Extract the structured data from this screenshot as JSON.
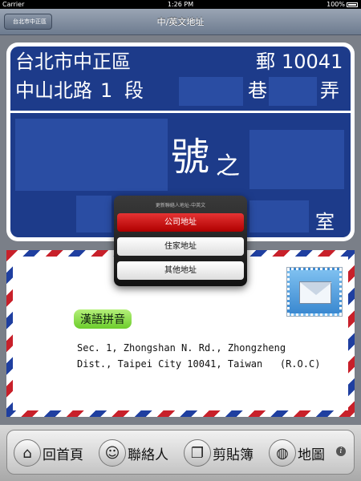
{
  "status_bar": {
    "carrier": "Carrier",
    "time": "1:26 PM",
    "battery": "100%"
  },
  "nav": {
    "back_label": "台北市中正區",
    "title": "中/英文地址"
  },
  "plate": {
    "city_district": "台北市中正區",
    "zip_label": "郵",
    "zip": "10041",
    "road": "中山北路",
    "section": "1",
    "section_unit": "段",
    "lane_unit": "巷",
    "alley_unit": "弄",
    "number_unit": "號",
    "of_char": "之",
    "room_unit": "室"
  },
  "popover": {
    "title": "更新聯絡人地址-中英文",
    "options": [
      {
        "label": "公司地址",
        "selected": true
      },
      {
        "label": "住家地址",
        "selected": false
      },
      {
        "label": "其他地址",
        "selected": false
      }
    ]
  },
  "envelope": {
    "badge": "漢語拼音",
    "address_line1": "Sec. 1, Zhongshan N. Rd., Zhongzheng",
    "address_line2": "Dist., Taipei City 10041, Taiwan   (R.O.C)"
  },
  "toolbar": {
    "items": [
      {
        "label": "回首頁",
        "icon": "home-icon"
      },
      {
        "label": "聯絡人",
        "icon": "contact-icon"
      },
      {
        "label": "剪貼簿",
        "icon": "clipboard-icon"
      },
      {
        "label": "地圖",
        "icon": "globe-icon"
      }
    ]
  },
  "colors": {
    "plate_blue": "#1d3b8a",
    "selected_red": "#c40000",
    "pinyin_green": "#7bd636"
  }
}
